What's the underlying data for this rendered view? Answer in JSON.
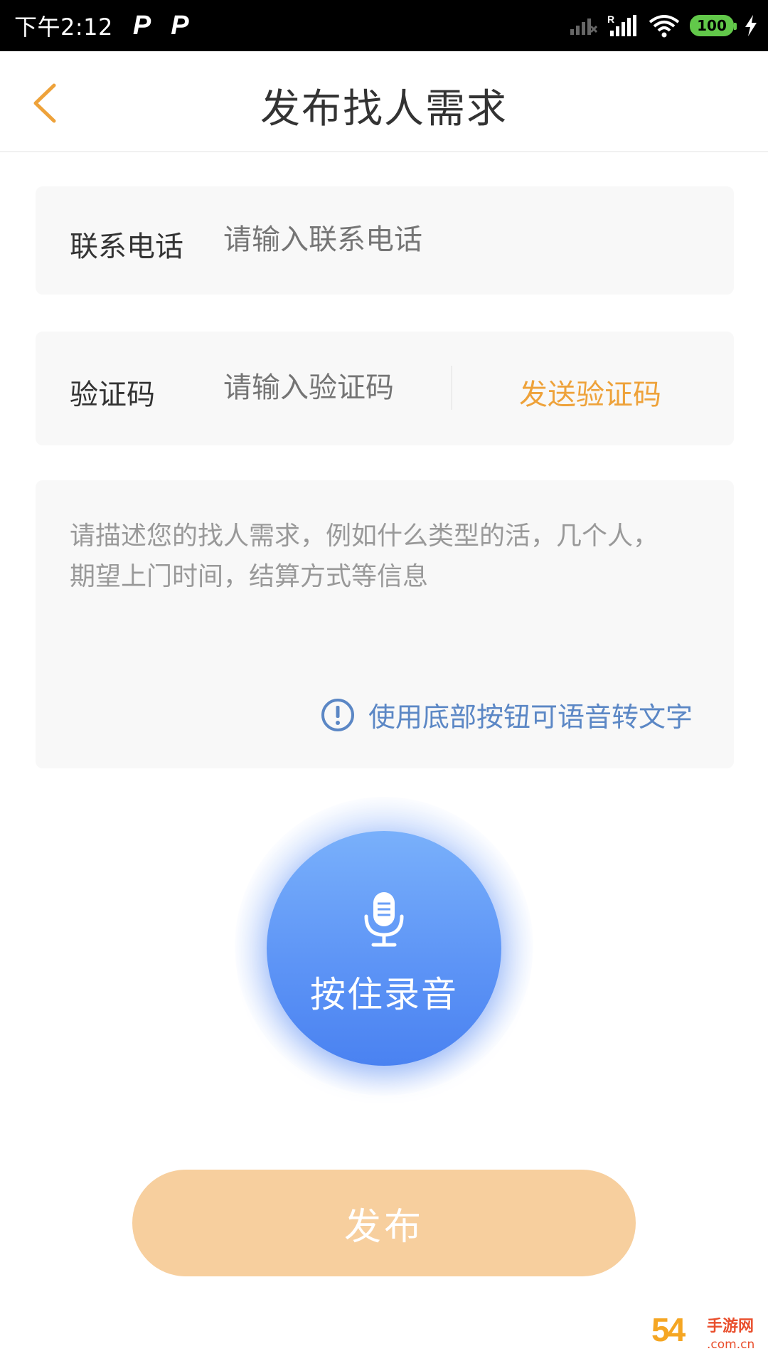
{
  "status_bar": {
    "time": "下午2:12",
    "notif_icon_1": "P",
    "notif_icon_2": "P",
    "battery": "100"
  },
  "header": {
    "title": "发布找人需求",
    "back_icon": "chevron-left-icon"
  },
  "phone_field": {
    "label": "联系电话",
    "placeholder": "请输入联系电话",
    "value": ""
  },
  "code_field": {
    "label": "验证码",
    "placeholder": "请输入验证码",
    "value": "",
    "send_label": "发送验证码"
  },
  "description": {
    "placeholder": "请描述您的找人需求，例如什么类型的活，几个人，期望上门时间，结算方式等信息",
    "tip": "使用底部按钮可语音转文字",
    "tip_icon": "info-icon"
  },
  "record": {
    "label": "按住录音",
    "icon": "microphone-icon"
  },
  "publish": {
    "label": "发布"
  },
  "watermark": {
    "main": "54",
    "line1": "手游网",
    "line2": ".com.cn"
  },
  "colors": {
    "accent": "#eea23a",
    "publish_bg": "#f7cf9e",
    "record_blue": "#5e95f6",
    "tip_blue": "#5b87c5"
  }
}
